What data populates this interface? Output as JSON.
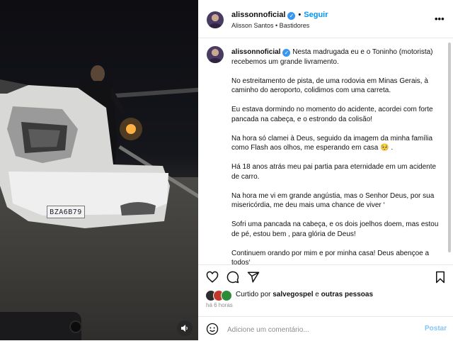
{
  "post": {
    "username": "alissonnoficial",
    "follow_label": "Seguir",
    "subtitle": "Alisson Santos • Bastidores",
    "more_glyph": "•••",
    "separator": "•",
    "verified_glyph": "✓"
  },
  "photo": {
    "license_plate": "BZA6B79",
    "sound_icon": "speaker-icon"
  },
  "caption": {
    "username": "alissonnoficial",
    "paragraphs": [
      "Nesta madrugada eu e o Toninho (motorista) recebemos um grande livramento.",
      "No estreitamento de pista, de uma rodovia em Minas Gerais, à caminho do aeroporto, colidimos com uma carreta.",
      "Eu estava dormindo no momento do acidente, acordei com forte pancada na cabeça, e o estrondo da colisão!",
      "Na hora só clamei à Deus, seguido da imagem da minha família como Flash aos olhos, me esperando em casa 🥺 .",
      "Há 18 anos atrás meu pai partia para eternidade em um acidente de carro.",
      "Na hora me vi em grande angústia, mas o Senhor Deus, por sua misericórdia, me deu mais uma chance de viver ‘",
      "Sofri uma pancada na cabeça, e os dois joelhos doem, mas estou de pé, estou bem , para glória de Deus!",
      "Continuem orando por mim e por minha casa! Deus abençoe a todos‘"
    ],
    "time": "6 h"
  },
  "actions": {
    "icons": [
      "heart-icon",
      "comment-icon",
      "share-icon",
      "bookmark-icon"
    ]
  },
  "likes": {
    "prefix": "Curtido por",
    "user": "salvegospel",
    "connector": "e",
    "others": "outras pessoas"
  },
  "posted_ago": "há 6 horas",
  "comment": {
    "placeholder": "Adicione um comentário...",
    "post_label": "Postar"
  },
  "colors": {
    "accent": "#0095f6",
    "verified": "#3897f0",
    "post_disabled": "#84c5f7",
    "muted_text": "#8e8e8e"
  }
}
